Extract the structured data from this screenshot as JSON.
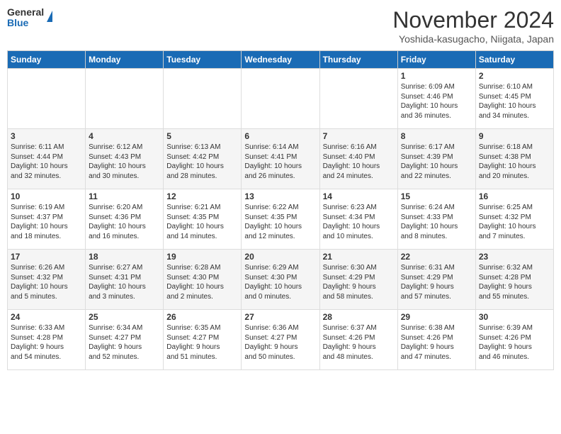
{
  "header": {
    "logo_general": "General",
    "logo_blue": "Blue",
    "title": "November 2024",
    "location": "Yoshida-kasugacho, Niigata, Japan"
  },
  "days_of_week": [
    "Sunday",
    "Monday",
    "Tuesday",
    "Wednesday",
    "Thursday",
    "Friday",
    "Saturday"
  ],
  "weeks": [
    [
      {
        "day": "",
        "info": ""
      },
      {
        "day": "",
        "info": ""
      },
      {
        "day": "",
        "info": ""
      },
      {
        "day": "",
        "info": ""
      },
      {
        "day": "",
        "info": ""
      },
      {
        "day": "1",
        "info": "Sunrise: 6:09 AM\nSunset: 4:46 PM\nDaylight: 10 hours\nand 36 minutes."
      },
      {
        "day": "2",
        "info": "Sunrise: 6:10 AM\nSunset: 4:45 PM\nDaylight: 10 hours\nand 34 minutes."
      }
    ],
    [
      {
        "day": "3",
        "info": "Sunrise: 6:11 AM\nSunset: 4:44 PM\nDaylight: 10 hours\nand 32 minutes."
      },
      {
        "day": "4",
        "info": "Sunrise: 6:12 AM\nSunset: 4:43 PM\nDaylight: 10 hours\nand 30 minutes."
      },
      {
        "day": "5",
        "info": "Sunrise: 6:13 AM\nSunset: 4:42 PM\nDaylight: 10 hours\nand 28 minutes."
      },
      {
        "day": "6",
        "info": "Sunrise: 6:14 AM\nSunset: 4:41 PM\nDaylight: 10 hours\nand 26 minutes."
      },
      {
        "day": "7",
        "info": "Sunrise: 6:16 AM\nSunset: 4:40 PM\nDaylight: 10 hours\nand 24 minutes."
      },
      {
        "day": "8",
        "info": "Sunrise: 6:17 AM\nSunset: 4:39 PM\nDaylight: 10 hours\nand 22 minutes."
      },
      {
        "day": "9",
        "info": "Sunrise: 6:18 AM\nSunset: 4:38 PM\nDaylight: 10 hours\nand 20 minutes."
      }
    ],
    [
      {
        "day": "10",
        "info": "Sunrise: 6:19 AM\nSunset: 4:37 PM\nDaylight: 10 hours\nand 18 minutes."
      },
      {
        "day": "11",
        "info": "Sunrise: 6:20 AM\nSunset: 4:36 PM\nDaylight: 10 hours\nand 16 minutes."
      },
      {
        "day": "12",
        "info": "Sunrise: 6:21 AM\nSunset: 4:35 PM\nDaylight: 10 hours\nand 14 minutes."
      },
      {
        "day": "13",
        "info": "Sunrise: 6:22 AM\nSunset: 4:35 PM\nDaylight: 10 hours\nand 12 minutes."
      },
      {
        "day": "14",
        "info": "Sunrise: 6:23 AM\nSunset: 4:34 PM\nDaylight: 10 hours\nand 10 minutes."
      },
      {
        "day": "15",
        "info": "Sunrise: 6:24 AM\nSunset: 4:33 PM\nDaylight: 10 hours\nand 8 minutes."
      },
      {
        "day": "16",
        "info": "Sunrise: 6:25 AM\nSunset: 4:32 PM\nDaylight: 10 hours\nand 7 minutes."
      }
    ],
    [
      {
        "day": "17",
        "info": "Sunrise: 6:26 AM\nSunset: 4:32 PM\nDaylight: 10 hours\nand 5 minutes."
      },
      {
        "day": "18",
        "info": "Sunrise: 6:27 AM\nSunset: 4:31 PM\nDaylight: 10 hours\nand 3 minutes."
      },
      {
        "day": "19",
        "info": "Sunrise: 6:28 AM\nSunset: 4:30 PM\nDaylight: 10 hours\nand 2 minutes."
      },
      {
        "day": "20",
        "info": "Sunrise: 6:29 AM\nSunset: 4:30 PM\nDaylight: 10 hours\nand 0 minutes."
      },
      {
        "day": "21",
        "info": "Sunrise: 6:30 AM\nSunset: 4:29 PM\nDaylight: 9 hours\nand 58 minutes."
      },
      {
        "day": "22",
        "info": "Sunrise: 6:31 AM\nSunset: 4:29 PM\nDaylight: 9 hours\nand 57 minutes."
      },
      {
        "day": "23",
        "info": "Sunrise: 6:32 AM\nSunset: 4:28 PM\nDaylight: 9 hours\nand 55 minutes."
      }
    ],
    [
      {
        "day": "24",
        "info": "Sunrise: 6:33 AM\nSunset: 4:28 PM\nDaylight: 9 hours\nand 54 minutes."
      },
      {
        "day": "25",
        "info": "Sunrise: 6:34 AM\nSunset: 4:27 PM\nDaylight: 9 hours\nand 52 minutes."
      },
      {
        "day": "26",
        "info": "Sunrise: 6:35 AM\nSunset: 4:27 PM\nDaylight: 9 hours\nand 51 minutes."
      },
      {
        "day": "27",
        "info": "Sunrise: 6:36 AM\nSunset: 4:27 PM\nDaylight: 9 hours\nand 50 minutes."
      },
      {
        "day": "28",
        "info": "Sunrise: 6:37 AM\nSunset: 4:26 PM\nDaylight: 9 hours\nand 48 minutes."
      },
      {
        "day": "29",
        "info": "Sunrise: 6:38 AM\nSunset: 4:26 PM\nDaylight: 9 hours\nand 47 minutes."
      },
      {
        "day": "30",
        "info": "Sunrise: 6:39 AM\nSunset: 4:26 PM\nDaylight: 9 hours\nand 46 minutes."
      }
    ]
  ]
}
